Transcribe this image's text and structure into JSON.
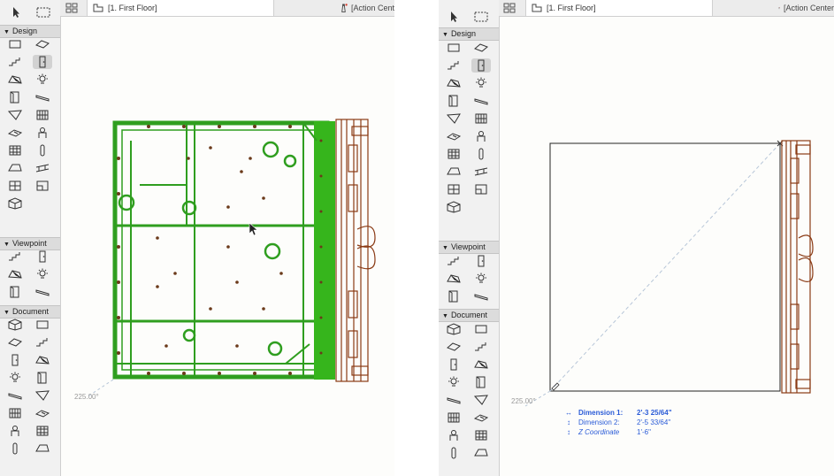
{
  "left": {
    "tab_active": "[1. First Floor]",
    "tab_inactive": "[Action Cent",
    "angle": "225.00°"
  },
  "right": {
    "tab_active": "[1. First Floor]",
    "tab_inactive": "[Action Center",
    "angle": "225.00°",
    "tracker": [
      {
        "icon": "↔",
        "label": "Dimension 1:",
        "value": "2'-3 25/64\""
      },
      {
        "icon": "↕",
        "label": "Dimension 2:",
        "value": "2'-5 33/64\""
      },
      {
        "icon": "↕",
        "label": "Z Coordinate",
        "value": "1'-6\""
      }
    ]
  },
  "toolbox": {
    "sections": [
      "Design",
      "Viewpoint",
      "Document"
    ],
    "design_tools": [
      "wall-icon",
      "column-icon",
      "beam-icon",
      "slab-icon",
      "roof-icon",
      "shell-icon",
      "stair-icon",
      "railing-icon",
      "curtain-wall-icon",
      "door-icon",
      "window-icon",
      "skylight-icon",
      "morph-icon",
      "zone-icon",
      "object-icon",
      "lamp-icon",
      "mesh-icon",
      "opening-icon",
      "wall-end-icon"
    ],
    "viewpoint_tools": [
      "section-icon",
      "elevation-icon",
      "interior-elevation-icon",
      "worksheet-icon",
      "detail-icon",
      "camera-icon"
    ],
    "document_tools": [
      "dimension-icon",
      "level-dimension-icon",
      "radial-dimension-icon",
      "angle-dimension-icon",
      "text-icon",
      "label-icon",
      "spot-dimension-icon",
      "change-icon",
      "fill-icon",
      "line-icon",
      "circle-icon",
      "arc-icon",
      "spline-icon",
      "hotspot-icon",
      "figure-icon",
      "drawing-icon"
    ]
  },
  "colors": {
    "selection_green": "#2f9e1f",
    "wall_brown": "#8a3a14",
    "tracker_blue": "#2a5bd7"
  }
}
